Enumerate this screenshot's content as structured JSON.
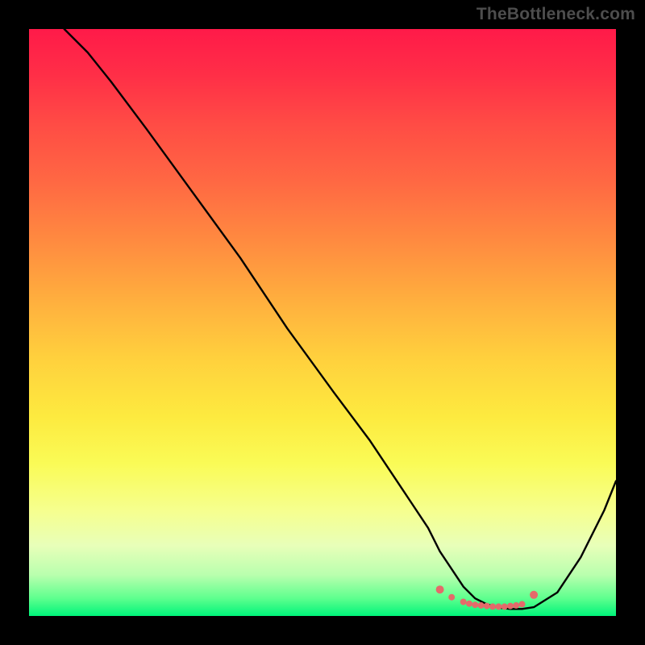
{
  "watermark": "TheBottleneck.com",
  "chart_data": {
    "type": "line",
    "title": "",
    "xlabel": "",
    "ylabel": "",
    "xlim": [
      0,
      100
    ],
    "ylim": [
      0,
      100
    ],
    "series": [
      {
        "name": "bottleneck-curve",
        "x": [
          6,
          10,
          14,
          20,
          28,
          36,
          44,
          52,
          58,
          64,
          68,
          70,
          72,
          74,
          76,
          78,
          80,
          82,
          84,
          86,
          90,
          94,
          98,
          100
        ],
        "y": [
          100,
          96,
          91,
          83,
          72,
          61,
          49,
          38,
          30,
          21,
          15,
          11,
          8,
          5,
          3,
          2,
          1.4,
          1.2,
          1.2,
          1.5,
          4,
          10,
          18,
          23
        ]
      },
      {
        "name": "trough-dots",
        "x": [
          70,
          72,
          74,
          75,
          76,
          77,
          78,
          79,
          80,
          81,
          82,
          83,
          84,
          86
        ],
        "y": [
          4.5,
          3.2,
          2.4,
          2.1,
          1.9,
          1.8,
          1.7,
          1.6,
          1.6,
          1.6,
          1.7,
          1.8,
          2.0,
          3.6
        ]
      }
    ],
    "colors": {
      "curve": "#000000",
      "dots": "#e46a6a"
    }
  }
}
